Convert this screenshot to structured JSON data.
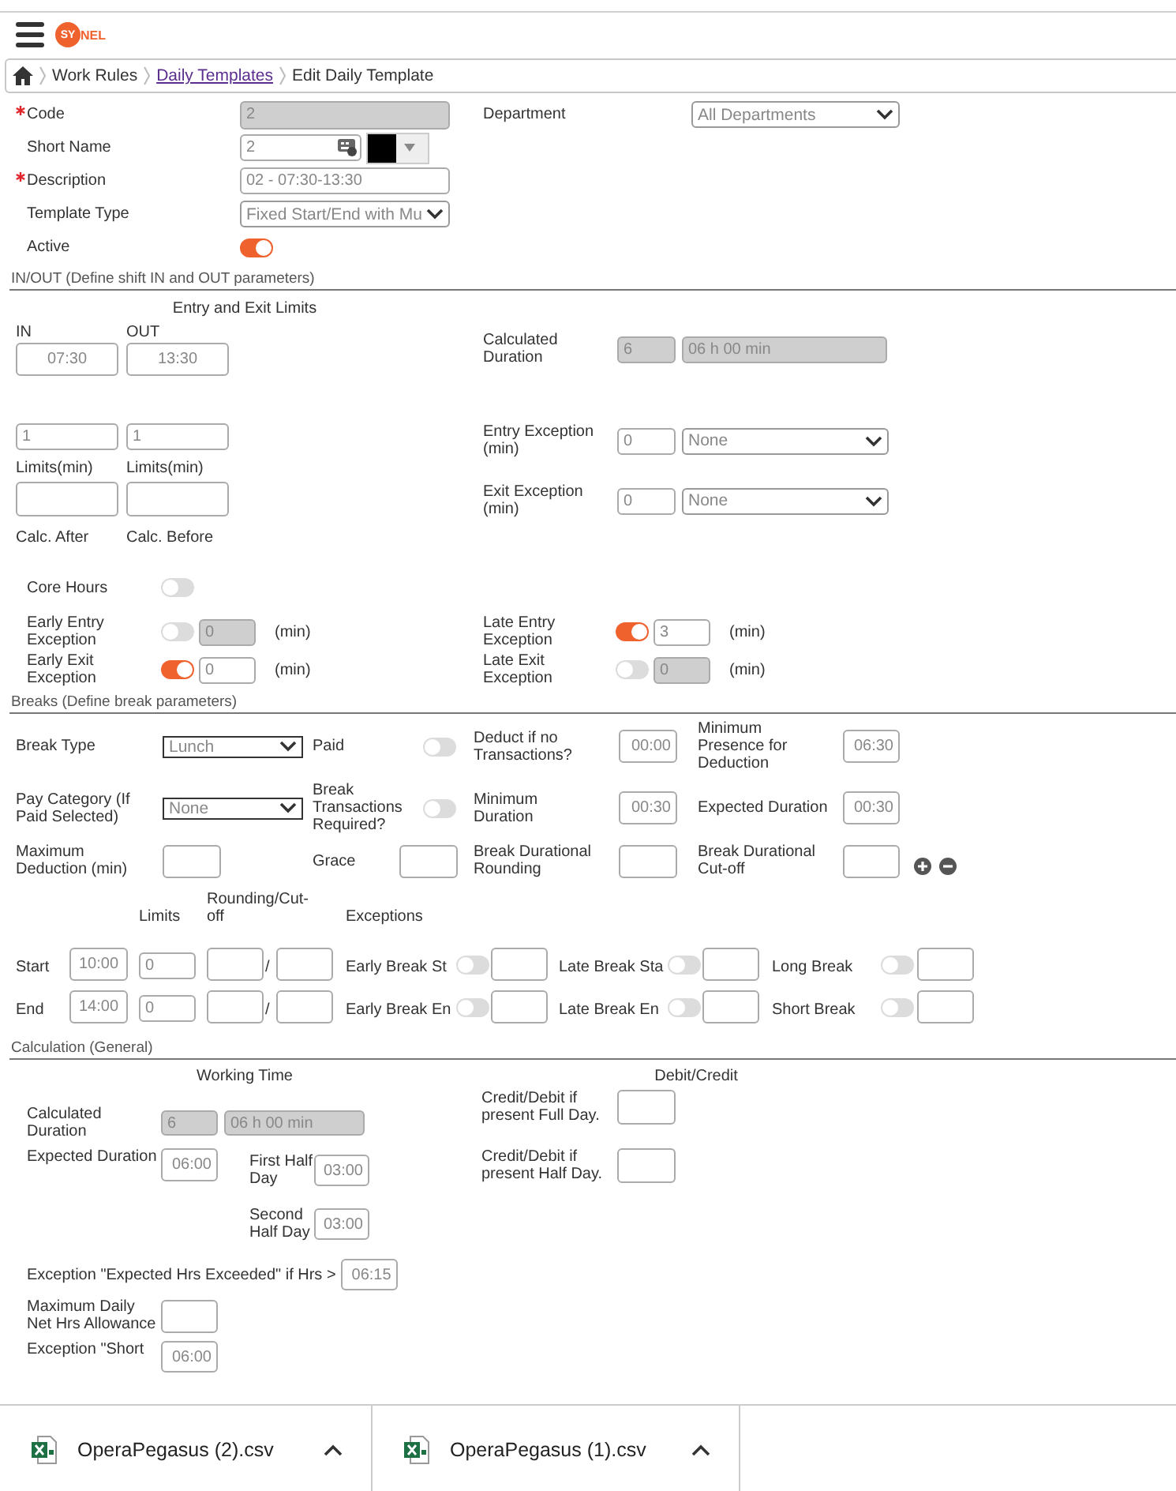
{
  "app": {
    "logo": [
      "SY",
      "NEL"
    ]
  },
  "breadcrumb": [
    {
      "label": "Work Rules",
      "link": false
    },
    {
      "label": "Daily Templates",
      "link": true
    },
    {
      "label": "Edit Daily Template",
      "link": false
    }
  ],
  "general": {
    "code": {
      "label": "Code",
      "required": true,
      "value": "2",
      "disabled": true
    },
    "short_name": {
      "label": "Short Name",
      "value": "2",
      "color": "#000000"
    },
    "description": {
      "label": "Description",
      "required": true,
      "value": "02 - 07:30-13:30"
    },
    "template_type": {
      "label": "Template Type",
      "value": "Fixed Start/End with Mu"
    },
    "active": {
      "label": "Active",
      "on": true
    },
    "department": {
      "label": "Department",
      "value": "All Departments"
    }
  },
  "in_out": {
    "title": "IN/OUT (Define shift IN and OUT parameters)",
    "limits_heading": "Entry and Exit Limits",
    "columns": [
      {
        "label": "IN",
        "time": "07:30",
        "limit": "1",
        "limit_label": "Limits(min)",
        "calc_label": "Calc. After"
      },
      {
        "label": "OUT",
        "time": "13:30",
        "limit": "1",
        "limit_label": "Limits(min)",
        "calc_label": "Calc. Before"
      }
    ],
    "calculated_duration": {
      "label": "Calculated Duration",
      "hours": "6",
      "text": "06 h 00 min",
      "disabled": true
    },
    "entry_exception": {
      "label": "Entry Exception (min)",
      "value": "0",
      "option": "None"
    },
    "exit_exception": {
      "label": "Exit Exception (min)",
      "value": "0",
      "option": "None"
    },
    "core_hours": {
      "label": "Core Hours",
      "on": false
    },
    "exceptions": [
      {
        "label": "Early Entry Exception",
        "on": false,
        "value": "0",
        "unit": "(min)"
      },
      {
        "label": "Late Entry Exception",
        "on": true,
        "value": "3",
        "unit": "(min)"
      },
      {
        "label": "Early Exit Exception",
        "on": true,
        "value": "0",
        "unit": "(min)"
      },
      {
        "label": "Late Exit Exception",
        "on": false,
        "value": "0",
        "unit": "(min)"
      }
    ]
  },
  "breaks": {
    "title": "Breaks (Define break parameters)",
    "break_type": {
      "label": "Break Type",
      "value": "Lunch"
    },
    "paid": {
      "label": "Paid",
      "on": false
    },
    "deduct": {
      "label": "Deduct if no Transactions?",
      "value": "00:00"
    },
    "min_presence": {
      "label": "Minimum Presence for Deduction",
      "value": "06:30"
    },
    "pay_category": {
      "label": "Pay Category (If Paid Selected)",
      "value": "None"
    },
    "break_transactions": {
      "label": "Break Transactions Required?",
      "on": false
    },
    "min_duration": {
      "label": "Minimum Duration",
      "value": "00:30"
    },
    "expected_duration": {
      "label": "Expected Duration",
      "value": "00:30"
    },
    "max_deduction": {
      "label": "Maximum Deduction (min)"
    },
    "grace": {
      "label": "Grace"
    },
    "rounding": {
      "label": "Break Durational Rounding"
    },
    "cutoff": {
      "label": "Break Durational Cut-off"
    },
    "headers": {
      "limits": "Limits",
      "rounding": "Rounding/Cut-off",
      "exceptions": "Exceptions"
    },
    "rows": [
      {
        "label": "Start",
        "time": "10:00",
        "limit": "0",
        "separator": "/",
        "exceptions": [
          {
            "label": "Early Break St",
            "on": false
          },
          {
            "label": "Late Break Sta",
            "on": false
          },
          {
            "label": "Long Break",
            "on": false
          }
        ]
      },
      {
        "label": "End",
        "time": "14:00",
        "limit": "0",
        "separator": "/",
        "exceptions": [
          {
            "label": "Early Break En",
            "on": false
          },
          {
            "label": "Late Break En",
            "on": false
          },
          {
            "label": "Short Break",
            "on": false
          }
        ]
      }
    ]
  },
  "calculation": {
    "title": "Calculation (General)",
    "working_time": "Working Time",
    "debit_credit": "Debit/Credit",
    "calculated_duration": {
      "label": "Calculated Duration",
      "hours": "6",
      "text": "06 h 00 min",
      "disabled": true
    },
    "expected_duration": {
      "label": "Expected Duration",
      "value": "06:00"
    },
    "half_days": [
      {
        "label": "First Half Day",
        "value": "03:00"
      },
      {
        "label": "Second Half Day",
        "value": "03:00"
      }
    ],
    "credits": [
      {
        "label": "Credit/Debit if present Full Day."
      },
      {
        "label": "Credit/Debit if present Half Day."
      }
    ],
    "expected_exceeded": {
      "label": "Exception \"Expected Hrs Exceeded\" if Hrs >",
      "value": "06:15"
    },
    "max_daily": {
      "label": "Maximum Daily Net Hrs Allowance"
    },
    "short_day": {
      "label": "Exception \"Short",
      "value": "06:00"
    }
  },
  "downloads": [
    {
      "name": "OperaPegasus (2).csv"
    },
    {
      "name": "OperaPegasus (1).csv"
    }
  ]
}
